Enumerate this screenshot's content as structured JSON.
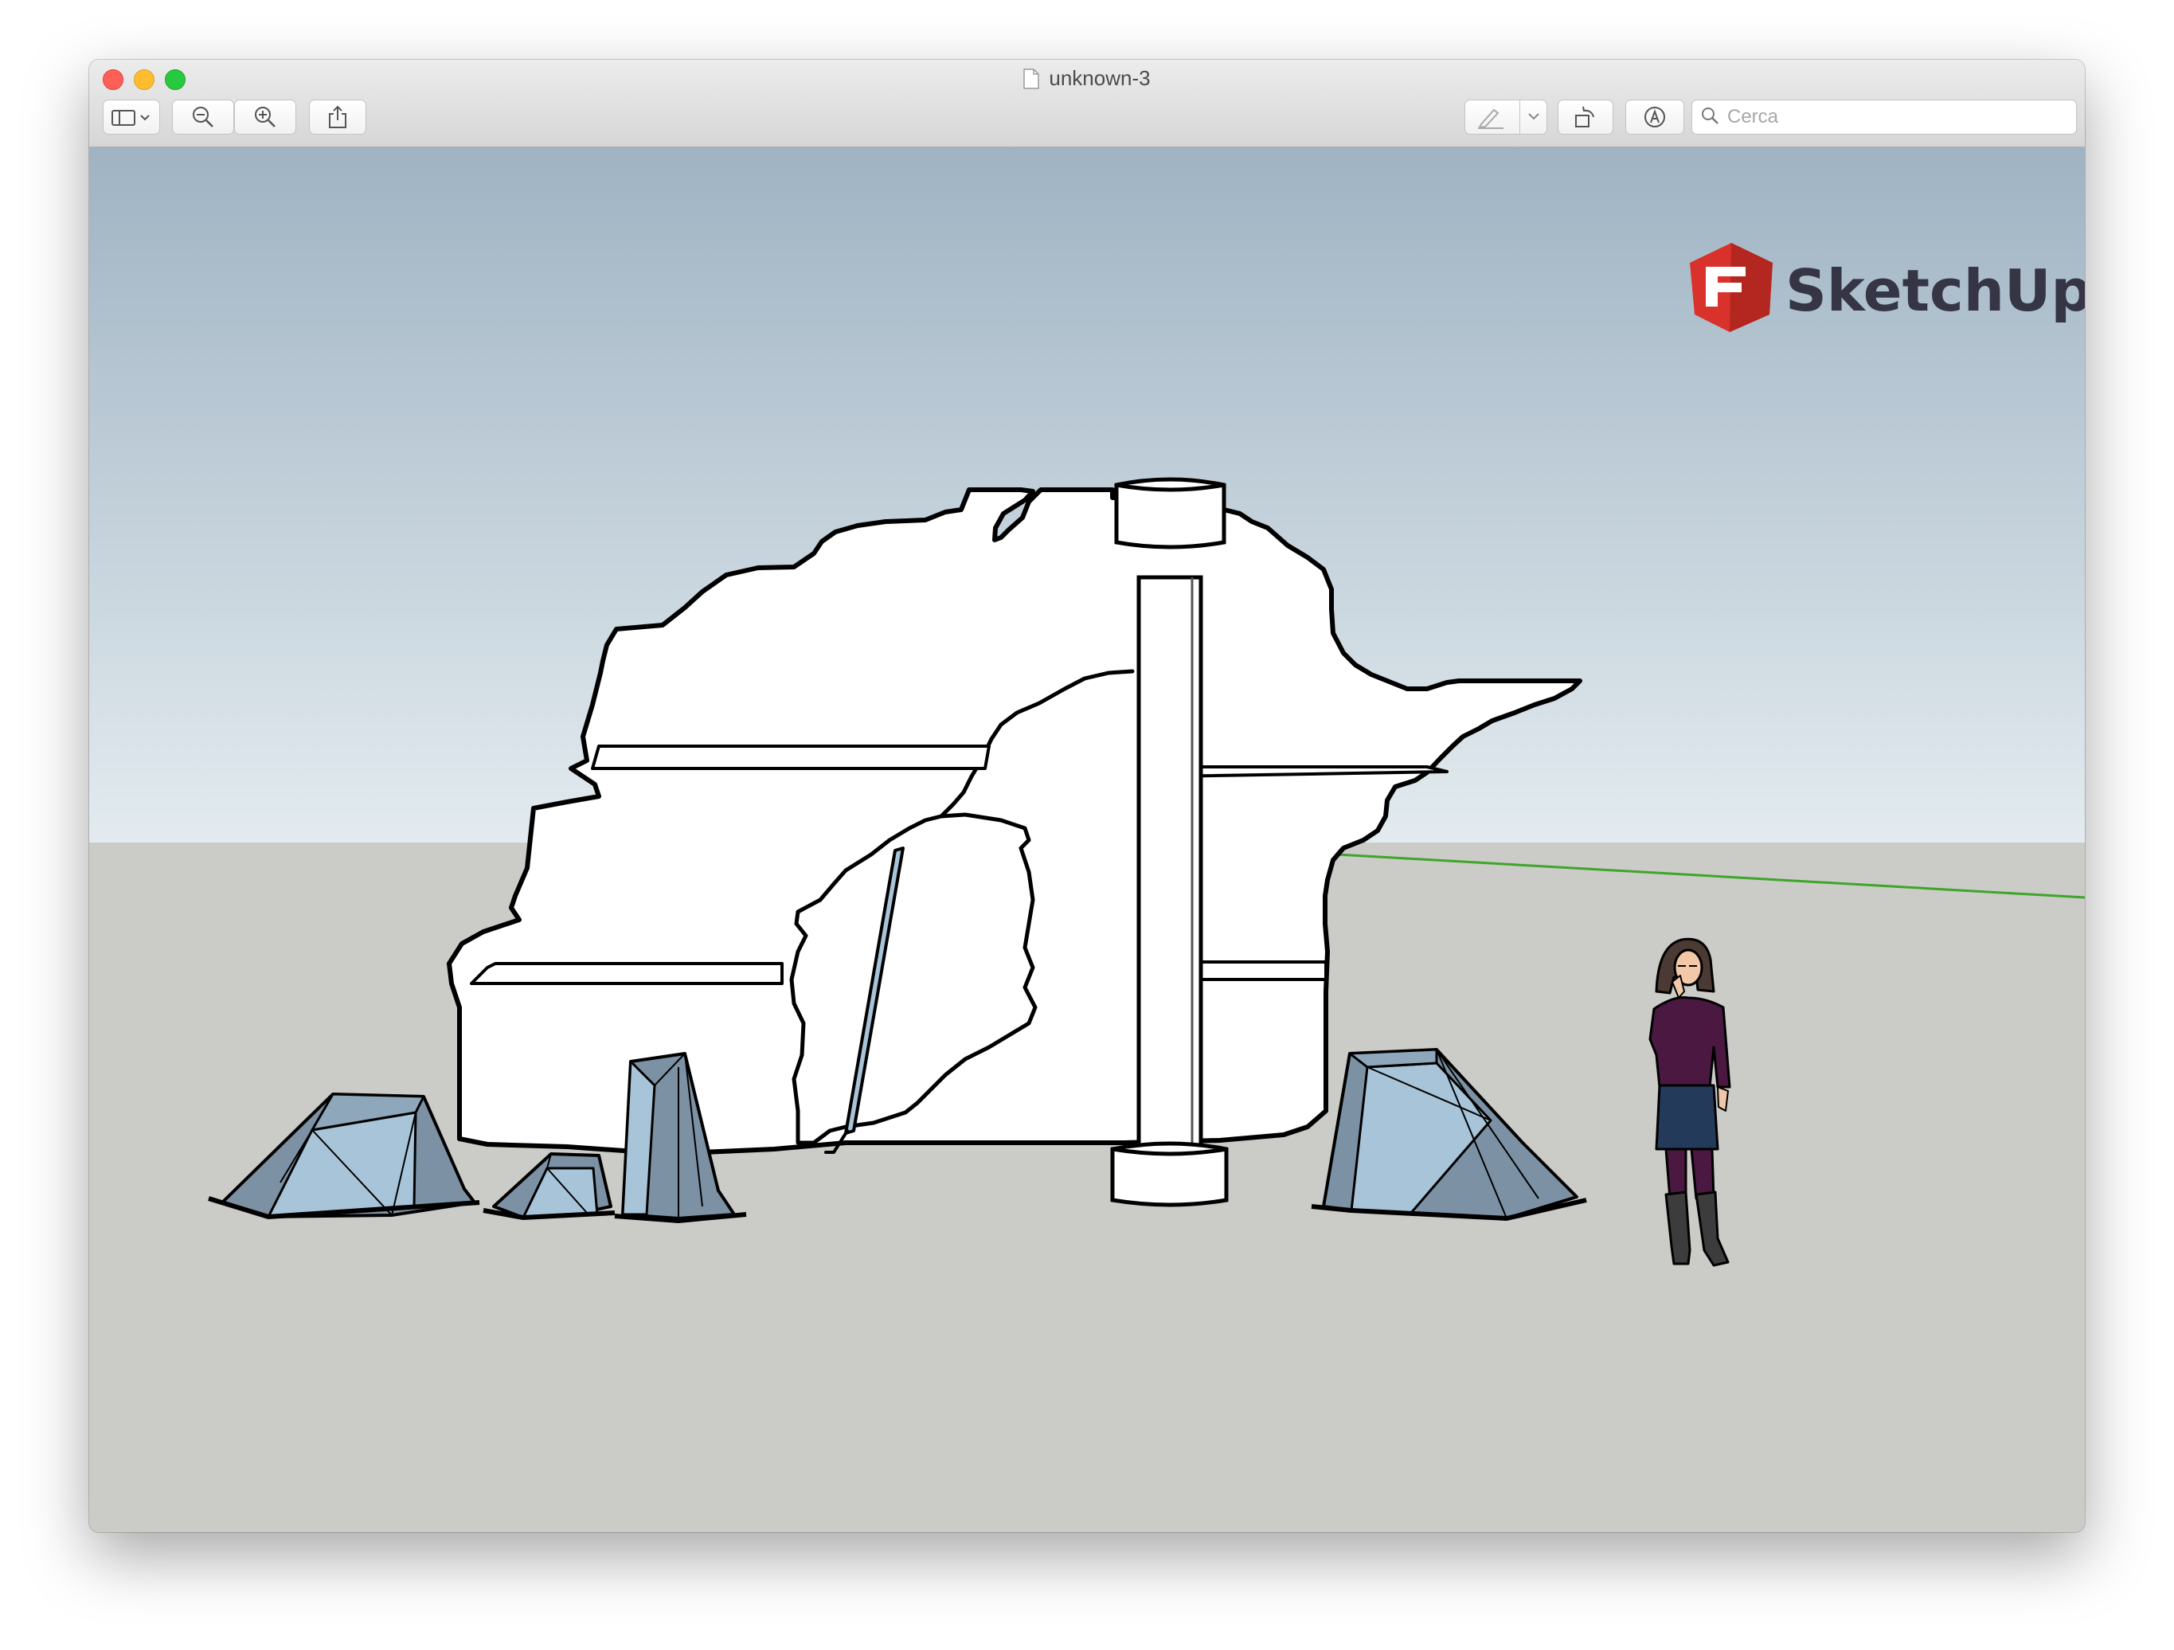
{
  "window": {
    "title": "unknown-3"
  },
  "toolbar": {
    "buttons": [
      {
        "name": "sidebar-toggle",
        "icon": "sidebar-icon"
      },
      {
        "name": "zoom-out",
        "icon": "zoom-out-icon"
      },
      {
        "name": "zoom-in",
        "icon": "zoom-in-icon"
      },
      {
        "name": "share",
        "icon": "share-icon"
      },
      {
        "name": "markup",
        "icon": "pen-icon"
      },
      {
        "name": "rotate",
        "icon": "rotate-icon"
      },
      {
        "name": "annotate",
        "icon": "markup-circle-icon"
      }
    ],
    "search": {
      "placeholder": "Cerca",
      "value": ""
    }
  },
  "viewport": {
    "logo_text": "SketchUp",
    "colors": {
      "sky_top": "#9fb3c3",
      "sky_bottom": "#e3ebef",
      "ground": "#cbcbc7",
      "rock_face": "#ffffff",
      "crystal_light": "#a7c4d8",
      "crystal_dark": "#7c92a4",
      "axis_green": "#3ea52a",
      "logo_red": "#d9322c"
    }
  }
}
